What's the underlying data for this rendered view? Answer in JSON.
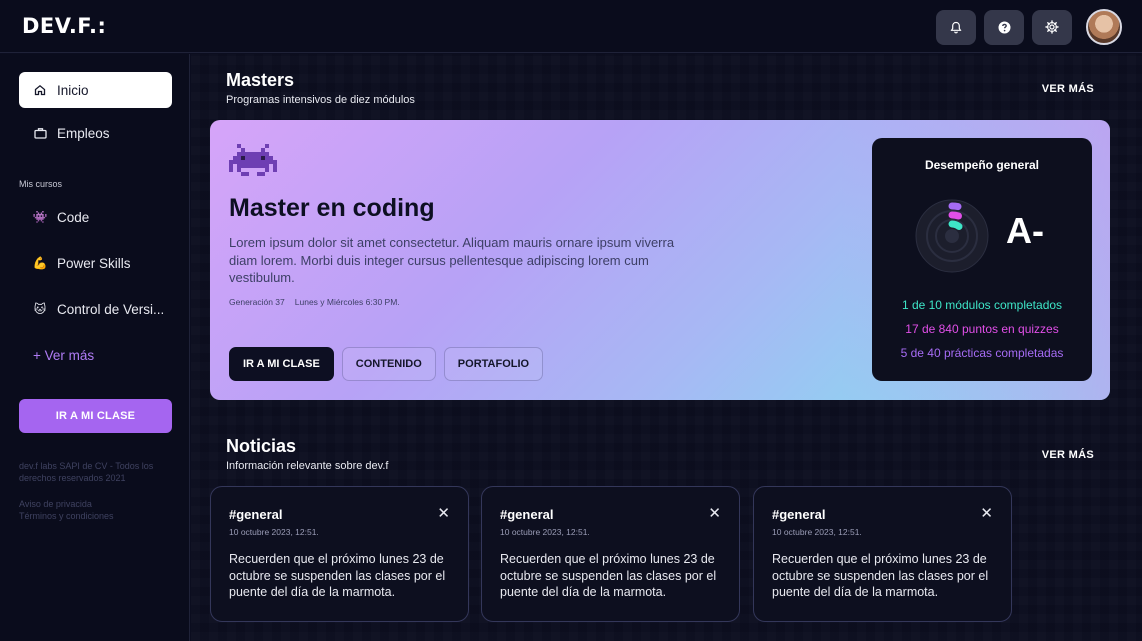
{
  "brand": {
    "logo_text": "DEV.F.:"
  },
  "topbar": {
    "icons": [
      "bell-icon",
      "help-icon",
      "settings-icon"
    ],
    "avatar": "user-avatar"
  },
  "sidebar": {
    "items": [
      {
        "label": "Inicio",
        "icon": "home-icon",
        "active": true
      },
      {
        "label": "Empleos",
        "icon": "briefcase-icon",
        "active": false
      }
    ],
    "section_label": "Mis cursos",
    "courses": [
      {
        "label": "Code",
        "icon": "👾"
      },
      {
        "label": "Power Skills",
        "icon": "💪"
      },
      {
        "label": "Control de Versi...",
        "icon": "🐱"
      }
    ],
    "more_label": "+ Ver más",
    "cta_label": "IR A MI CLASE",
    "footer_legal": "dev.f labs SAPI de CV - Todos los derechos reservados 2021",
    "footer_privacy": "Aviso de privacida",
    "footer_terms": "Términos y condiciones"
  },
  "masters": {
    "title": "Masters",
    "subtitle": "Programas intensivos de diez módulos",
    "see_more": "VER MÁS",
    "card": {
      "title": "Master en coding",
      "description": "Lorem ipsum dolor sit amet consectetur. Aliquam mauris ornare ipsum viverra diam lorem. Morbi duis integer cursus pellentesque adipiscing lorem cum vestibulum.",
      "generation": "Generación 37",
      "schedule": "Lunes y Miércoles 6:30 PM.",
      "buttons": {
        "primary": "IR A MI CLASE",
        "content": "CONTENIDO",
        "portfolio": "PORTAFOLIO"
      },
      "performance": {
        "title": "Desempeño general",
        "grade": "A-",
        "modules": "1 de 10 módulos completados",
        "points": "17 de 840 puntos en quizzes",
        "practices": "5 de 40 prácticas completadas",
        "colors": {
          "modules": "#3ee6c8",
          "points": "#e14fe8",
          "practices": "#a66cf5"
        }
      }
    }
  },
  "news": {
    "title": "Noticias",
    "subtitle": "Información relevante sobre dev.f",
    "see_more": "VER MÁS",
    "cards": [
      {
        "tag": "#general",
        "date": "10 octubre 2023, 12:51.",
        "body": "Recuerden que el próximo lunes 23 de octubre se suspenden las clases por el puente del día de la marmota."
      },
      {
        "tag": "#general",
        "date": "10 octubre 2023, 12:51.",
        "body": "Recuerden que el próximo lunes 23 de octubre se suspenden las clases por el puente del día de la marmota."
      },
      {
        "tag": "#general",
        "date": "10 octubre 2023, 12:51.",
        "body": "Recuerden que el próximo lunes 23 de octubre se suspenden las clases por el puente del día de la marmota."
      }
    ]
  }
}
